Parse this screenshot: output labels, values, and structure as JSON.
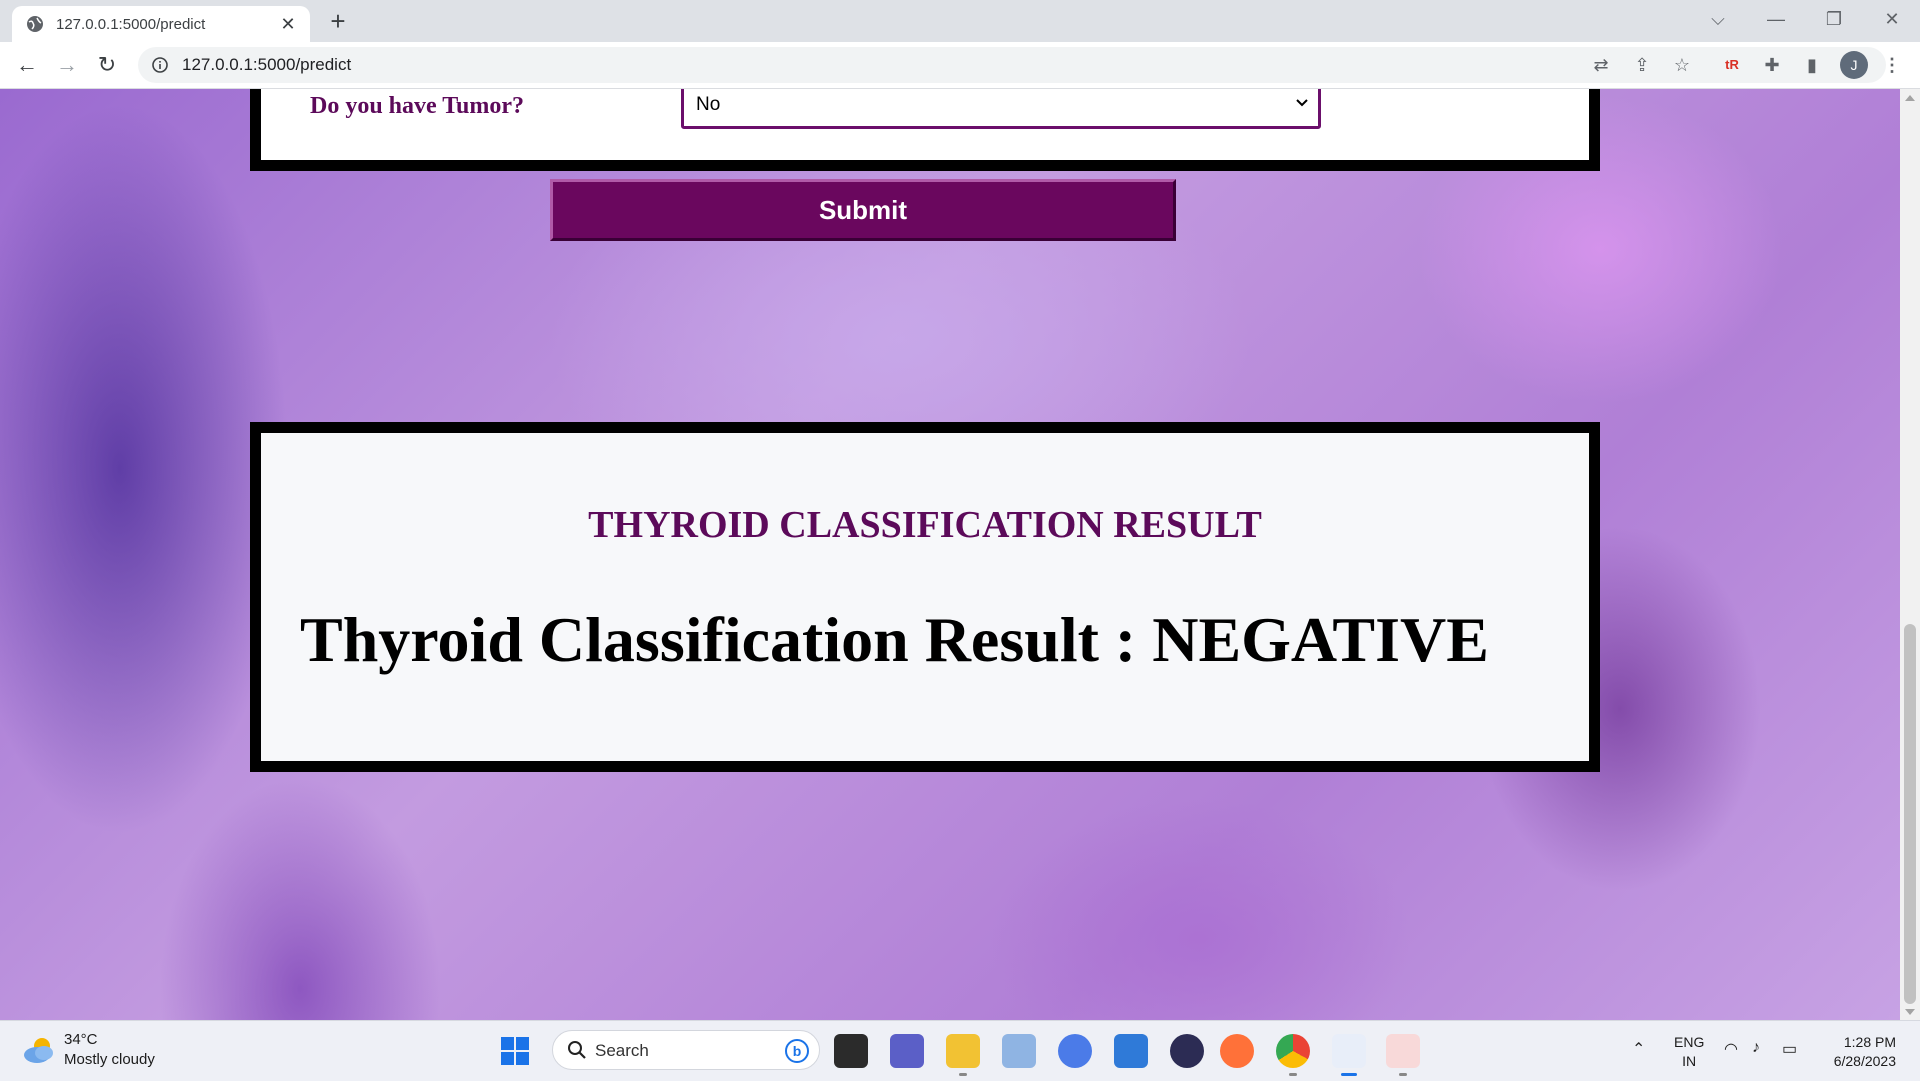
{
  "browser": {
    "tab_title": "127.0.0.1:5000/predict",
    "new_tab_symbol": "+",
    "url": "127.0.0.1:5000/predict",
    "profile_initial": "J"
  },
  "form": {
    "question_label": "Do you have Tumor?",
    "selected_option": "No",
    "submit_label": "Submit"
  },
  "result": {
    "heading": "THYROID CLASSIFICATION RESULT",
    "text": "Thyroid Classification Result : NEGATIVE"
  },
  "taskbar": {
    "weather_temp": "34°C",
    "weather_desc": "Mostly cloudy",
    "search_placeholder": "Search",
    "lang_line1": "ENG",
    "lang_line2": "IN",
    "time": "1:28 PM",
    "date": "6/28/2023"
  },
  "colors": {
    "accent_purple": "#5c0a5a",
    "submit_bg": "#6a075e"
  }
}
